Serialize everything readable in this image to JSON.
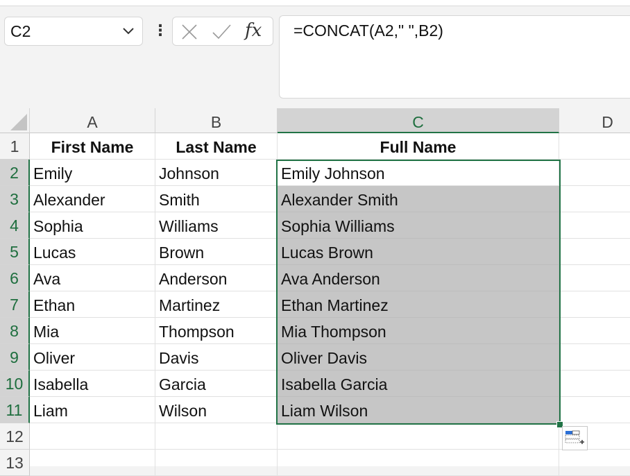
{
  "name_box": {
    "value": "C2"
  },
  "formula_bar": {
    "formula": "=CONCAT(A2,\" \",B2)",
    "fx_label": "fx"
  },
  "columns": [
    "A",
    "B",
    "C",
    "D"
  ],
  "rows": [
    "1",
    "2",
    "3",
    "4",
    "5",
    "6",
    "7",
    "8",
    "9",
    "10",
    "11",
    "12",
    "13"
  ],
  "headers": {
    "first": "First Name",
    "last": "Last Name",
    "full": "Full Name"
  },
  "data": [
    {
      "first": "Emily",
      "last": "Johnson",
      "full": "Emily Johnson"
    },
    {
      "first": "Alexander",
      "last": "Smith",
      "full": "Alexander Smith"
    },
    {
      "first": "Sophia",
      "last": "Williams",
      "full": "Sophia Williams"
    },
    {
      "first": "Lucas",
      "last": "Brown",
      "full": "Lucas Brown"
    },
    {
      "first": "Ava",
      "last": "Anderson",
      "full": "Ava Anderson"
    },
    {
      "first": "Ethan",
      "last": "Martinez",
      "full": "Ethan Martinez"
    },
    {
      "first": "Mia",
      "last": "Thompson",
      "full": "Mia Thompson"
    },
    {
      "first": "Oliver",
      "last": "Davis",
      "full": "Oliver Davis"
    },
    {
      "first": "Isabella",
      "last": "Garcia",
      "full": "Isabella Garcia"
    },
    {
      "first": "Liam",
      "last": "Wilson",
      "full": "Liam Wilson"
    }
  ],
  "icons": {
    "dropdown": "chevron-down-icon",
    "more": "more-vertical-icon",
    "cancel": "cancel-x-icon",
    "enter": "checkmark-icon",
    "insert_function": "fx-icon",
    "quick_analysis": "quick-analysis-icon"
  },
  "colors": {
    "accent": "#217346",
    "selected_fill": "#c6c6c6",
    "header_bg": "#f3f3f3"
  }
}
